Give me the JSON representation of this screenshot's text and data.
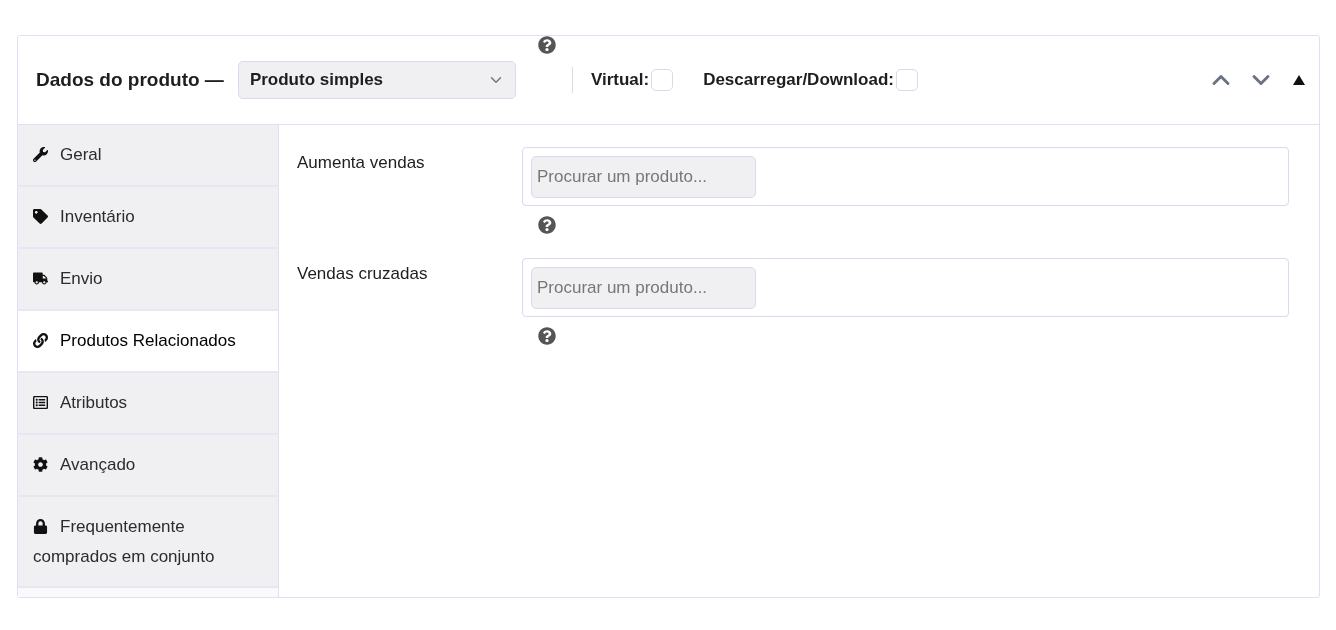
{
  "header": {
    "title": "Dados do produto —",
    "product_type": "Produto simples",
    "options": [
      {
        "label": "Virtual:",
        "checked": false
      },
      {
        "label": "Descarregar/Download:",
        "checked": false
      }
    ]
  },
  "tabs": [
    {
      "label": "Geral",
      "kind": "wrench",
      "selected": false
    },
    {
      "label": "Inventário",
      "kind": "tag",
      "selected": false
    },
    {
      "label": "Envio",
      "kind": "truck",
      "selected": false
    },
    {
      "label": "Produtos Relacionados",
      "kind": "link",
      "selected": true
    },
    {
      "label": "Atributos",
      "kind": "list",
      "selected": false
    },
    {
      "label": "Avançado",
      "kind": "gear",
      "selected": false
    },
    {
      "label": "Frequentemente comprados em conjunto",
      "kind": "lock",
      "selected": false
    }
  ],
  "fields": [
    {
      "label": "Aumenta vendas",
      "placeholder": "Procurar um produto..."
    },
    {
      "label": "Vendas cruzadas",
      "placeholder": "Procurar um produto..."
    }
  ]
}
